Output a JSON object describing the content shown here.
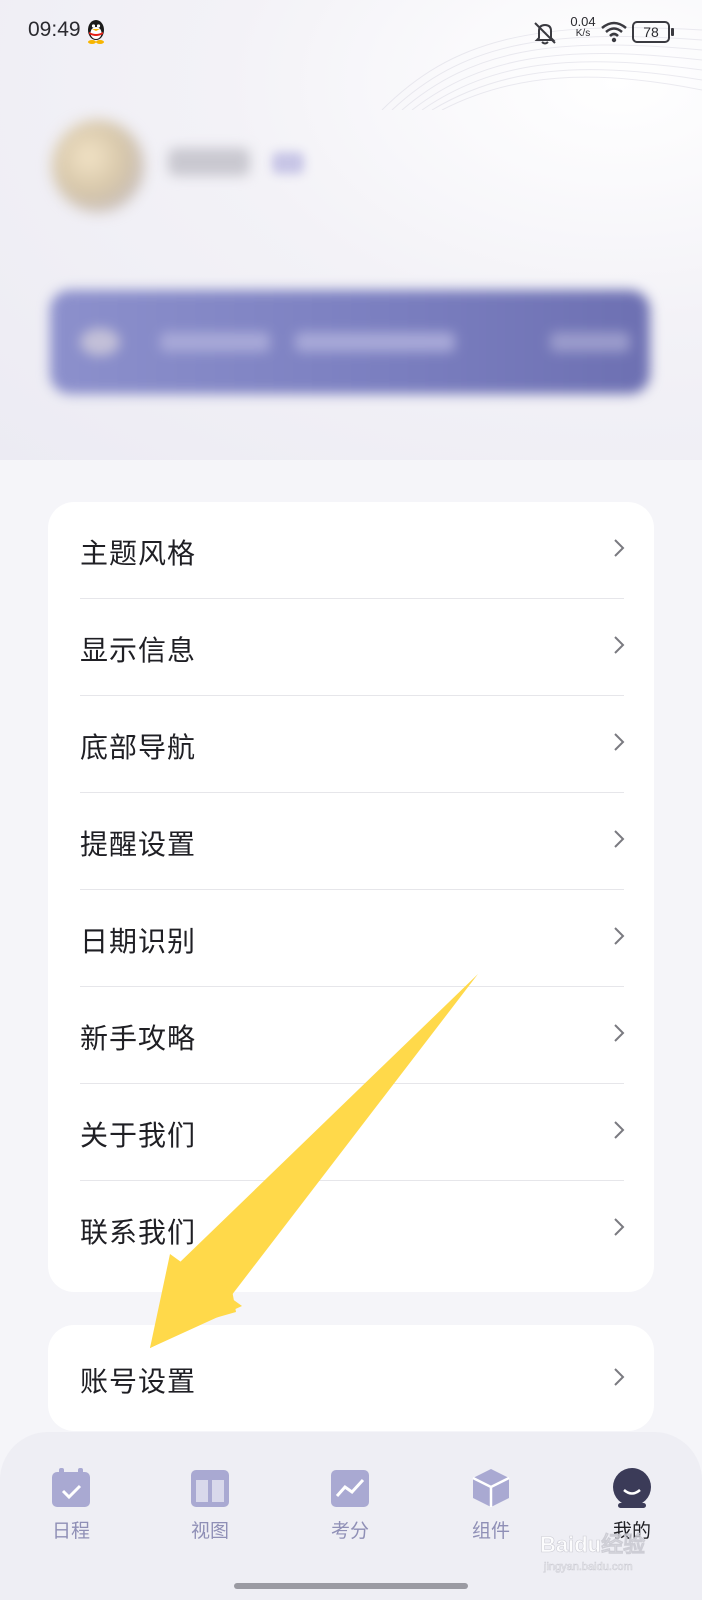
{
  "status_bar": {
    "time": "09:49",
    "net_speed_value": "0.04",
    "net_speed_unit": "K/s",
    "battery": "78"
  },
  "settings_menu": {
    "items": [
      {
        "label": "主题风格"
      },
      {
        "label": "显示信息"
      },
      {
        "label": "底部导航"
      },
      {
        "label": "提醒设置"
      },
      {
        "label": "日期识别"
      },
      {
        "label": "新手攻略"
      },
      {
        "label": "关于我们"
      },
      {
        "label": "联系我们"
      }
    ]
  },
  "account": {
    "label": "账号设置"
  },
  "bottom_nav": {
    "tabs": [
      {
        "label": "日程",
        "icon": "calendar-icon"
      },
      {
        "label": "视图",
        "icon": "layout-icon"
      },
      {
        "label": "考分",
        "icon": "score-chart-icon"
      },
      {
        "label": "组件",
        "icon": "cube-icon"
      },
      {
        "label": "我的",
        "icon": "profile-icon",
        "active": true
      }
    ]
  },
  "watermark": {
    "brand": "Baidu经验",
    "url": "jingyan.baidu.com"
  },
  "colors": {
    "accent": "#8f8fb6",
    "annotation_arrow": "#ffd94a",
    "card": "#ffffff",
    "background": "#f5f5f9"
  }
}
